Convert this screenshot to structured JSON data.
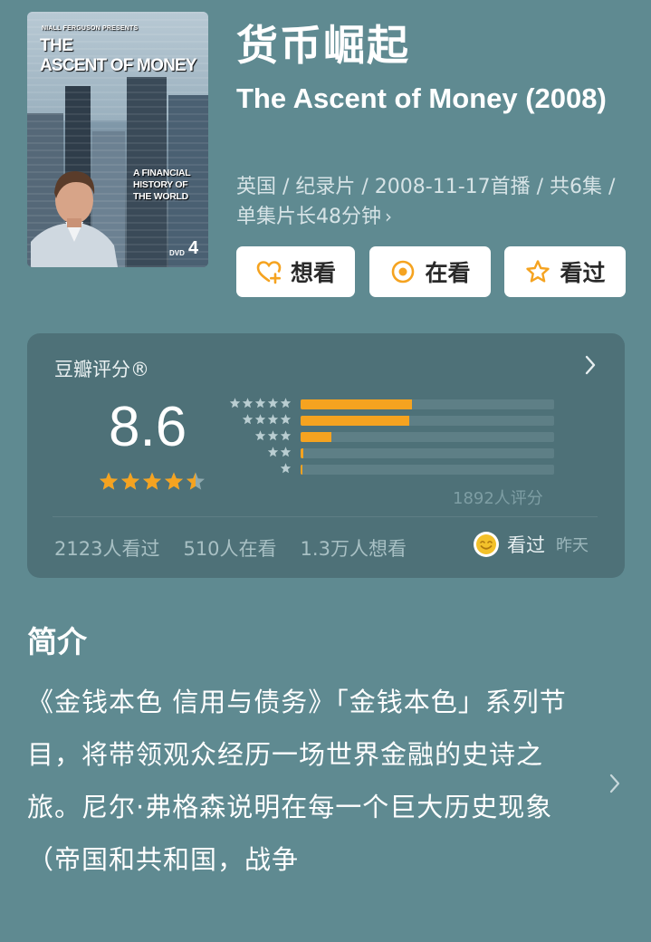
{
  "poster": {
    "presenter": "NIALL FERGUSON PRESENTS",
    "title_line1": "THE",
    "title_line2": "ASCENT OF MONEY",
    "subtitle": "A FINANCIAL HISTORY OF THE WORLD",
    "dvd_label": "DVD",
    "channel_label": "4"
  },
  "title": {
    "chinese": "货币崛起",
    "original": "The Ascent of Money (2008)"
  },
  "meta": "英国 / 纪录片 / 2008-11-17首播 / 共6集 / 单集片长48分钟",
  "actions": {
    "want": "想看",
    "doing": "在看",
    "done": "看过"
  },
  "rating": {
    "label": "豆瓣评分®",
    "score": "8.6",
    "stars": 4.5,
    "distribution": [
      {
        "stars": 5,
        "fraction": 0.44
      },
      {
        "stars": 4,
        "fraction": 0.43
      },
      {
        "stars": 3,
        "fraction": 0.12
      },
      {
        "stars": 2,
        "fraction": 0.01
      },
      {
        "stars": 1,
        "fraction": 0.005
      }
    ],
    "count": "1892人评分",
    "stats": {
      "watched": "2123人看过",
      "watching": "510人在看",
      "want": "1.3万人想看"
    },
    "mine": {
      "label": "看过",
      "time": "昨天"
    }
  },
  "intro": {
    "heading": "简介",
    "body": "《金钱本色 信用与债务》「金钱本色」系列节目，将带领观众经历一场世界金融的史诗之旅。尼尔·弗格森说明在每一个巨大历史现象（帝国和共和国，战争"
  },
  "colors": {
    "background": "#5f8a91",
    "card": "#4e7178",
    "accent": "#f5a320"
  }
}
